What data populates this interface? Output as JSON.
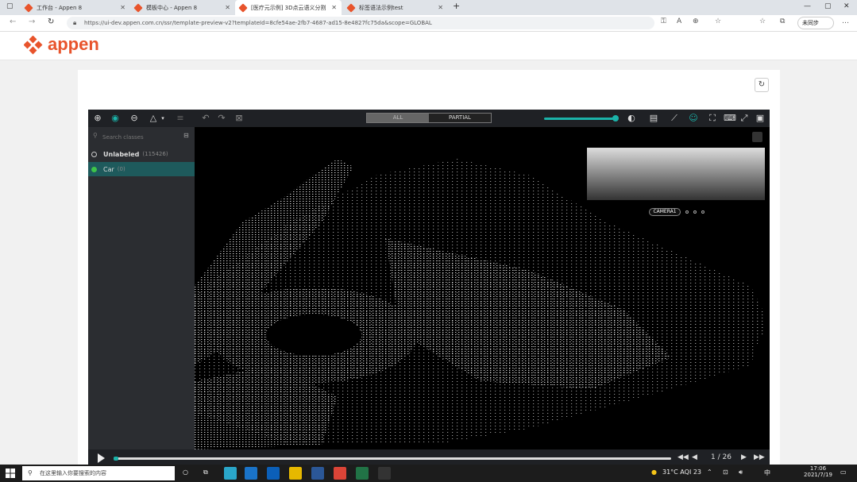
{
  "browser": {
    "tabs": [
      {
        "label": "工作台 - Appen 8"
      },
      {
        "label": "模板中心 - Appen 8"
      },
      {
        "label": "[医疗元示例] 3D点云语义分割"
      },
      {
        "label": "标签语法示例test"
      }
    ],
    "new_tab": "+",
    "url": "https://ui-dev.appen.com.cn/ssr/template-preview-v2?templateId=8cfe54ae-2fb7-4687-ad15-8e4827fc75da&scope=GLOBAL",
    "sync_label": "未同步"
  },
  "header": {
    "logo_text": "appen"
  },
  "tool": {
    "toggle_all": "ALL",
    "toggle_partial": "PARTIAL",
    "search_placeholder": "Search classes",
    "classes": [
      {
        "label": "Unlabeled",
        "count": "(115426)",
        "color": "#2b2d31"
      },
      {
        "label": "Car",
        "count": "(0)",
        "color": "#3ec34a"
      }
    ],
    "camera_label": "CAMERA1",
    "frame": "1 / 26",
    "progress": 0.005
  },
  "taskbar": {
    "search_placeholder": "在这里输入你要搜索的内容",
    "weather": "31°C AQI 23",
    "ime": "中",
    "time": "17:06",
    "date": "2021/7/19"
  },
  "colors": {
    "accent": "#1bb3a9",
    "brand": "#e8542c"
  }
}
